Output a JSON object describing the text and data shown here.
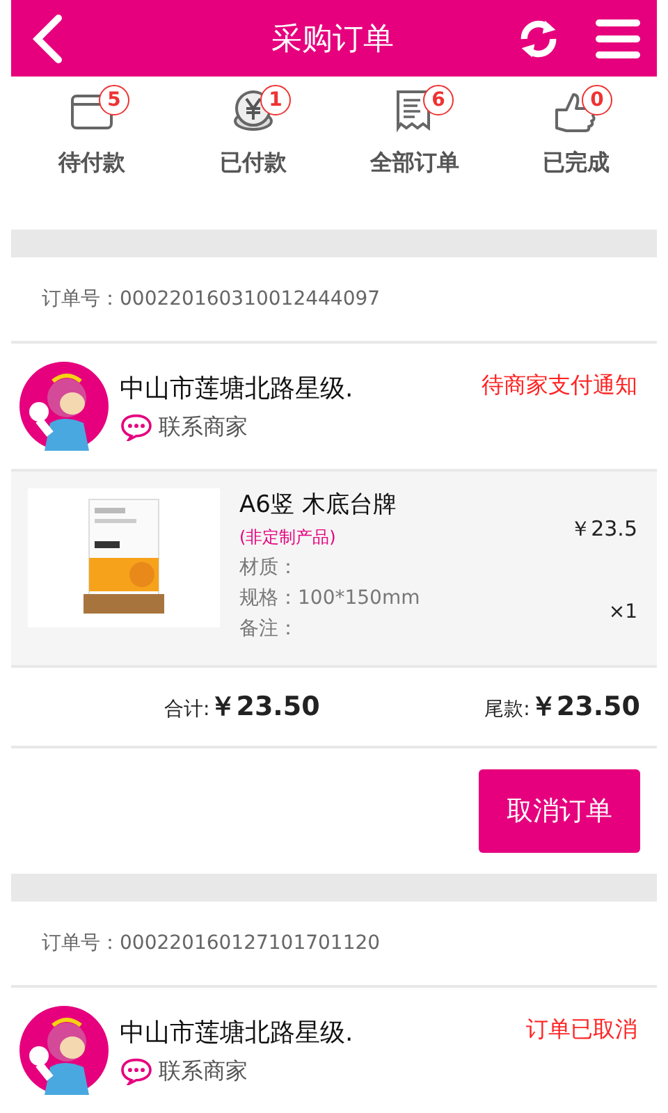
{
  "header": {
    "title": "采购订单"
  },
  "status_tabs": [
    {
      "kind": "wallet",
      "label": "待付款",
      "count": "5"
    },
    {
      "kind": "coin",
      "label": "已付款",
      "count": "1"
    },
    {
      "kind": "receipt",
      "label": "全部订单",
      "count": "6"
    },
    {
      "kind": "thumbs-up",
      "label": "已完成",
      "count": "0"
    }
  ],
  "orders": [
    {
      "order_no": "订单号：000220160310012444097",
      "merchant": "中山市莲塘北路星级.",
      "contact": "联系商家",
      "status": "待商家支付通知",
      "items": [
        {
          "name": "A6竖 木底台牌",
          "tag": "(非定制产品)",
          "attributes": [
            "材质：",
            "规格：100*150mm",
            "备注："
          ],
          "price": "￥23.5",
          "qty": "×1"
        }
      ],
      "total_label": "合计:",
      "total": "￥23.50",
      "balance_label": "尾款:",
      "balance": "￥23.50",
      "actions": [
        "取消订单"
      ]
    },
    {
      "order_no": "订单号：000220160127101701120",
      "merchant": "中山市莲塘北路星级.",
      "contact": "联系商家",
      "status": "订单已取消"
    }
  ]
}
